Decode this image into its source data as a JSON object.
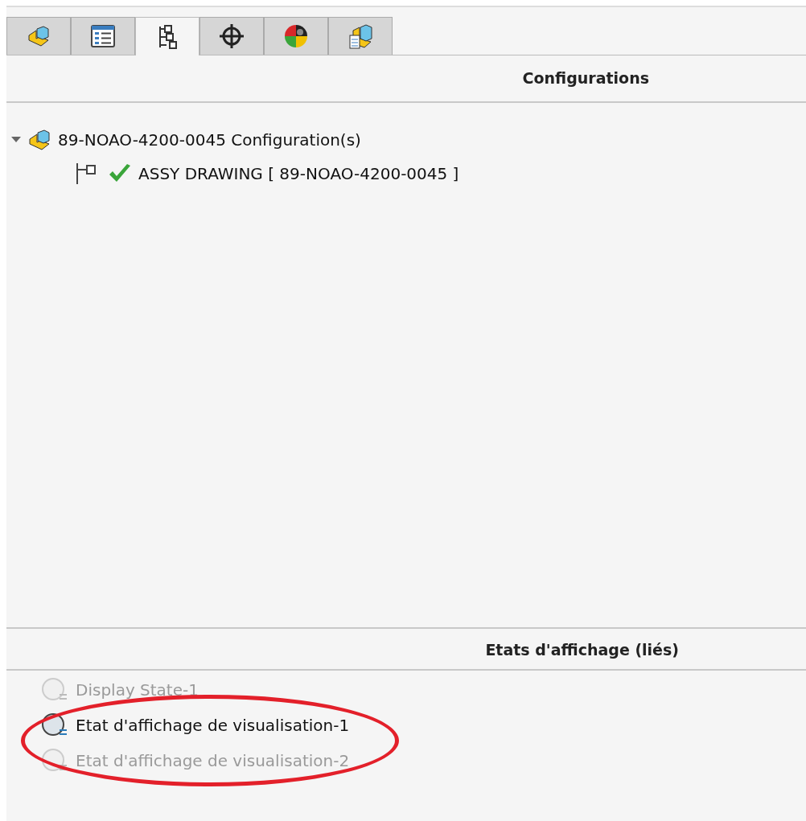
{
  "tabs": [
    {
      "kind": "part",
      "selected": false
    },
    {
      "kind": "properties",
      "selected": false
    },
    {
      "kind": "configuration",
      "selected": true
    },
    {
      "kind": "crosshair",
      "selected": false
    },
    {
      "kind": "appearance",
      "selected": false
    },
    {
      "kind": "document",
      "selected": false
    }
  ],
  "configurations": {
    "title": "Configurations",
    "tree": [
      {
        "label": "89-NOAO-4200-0045 Configuration(s)",
        "expanded": true,
        "children": [
          {
            "label": "ASSY DRAWING [ 89-NOAO-4200-0045 ]",
            "active": true
          }
        ]
      }
    ]
  },
  "display_states": {
    "title": "Etats d'affichage (liés)",
    "items": [
      {
        "label": "Display State-1",
        "active": false,
        "circled": false
      },
      {
        "label": "Etat d'affichage de visualisation-1",
        "active": true,
        "circled": true
      },
      {
        "label": "Etat d'affichage de visualisation-2",
        "active": false,
        "circled": true
      }
    ]
  }
}
